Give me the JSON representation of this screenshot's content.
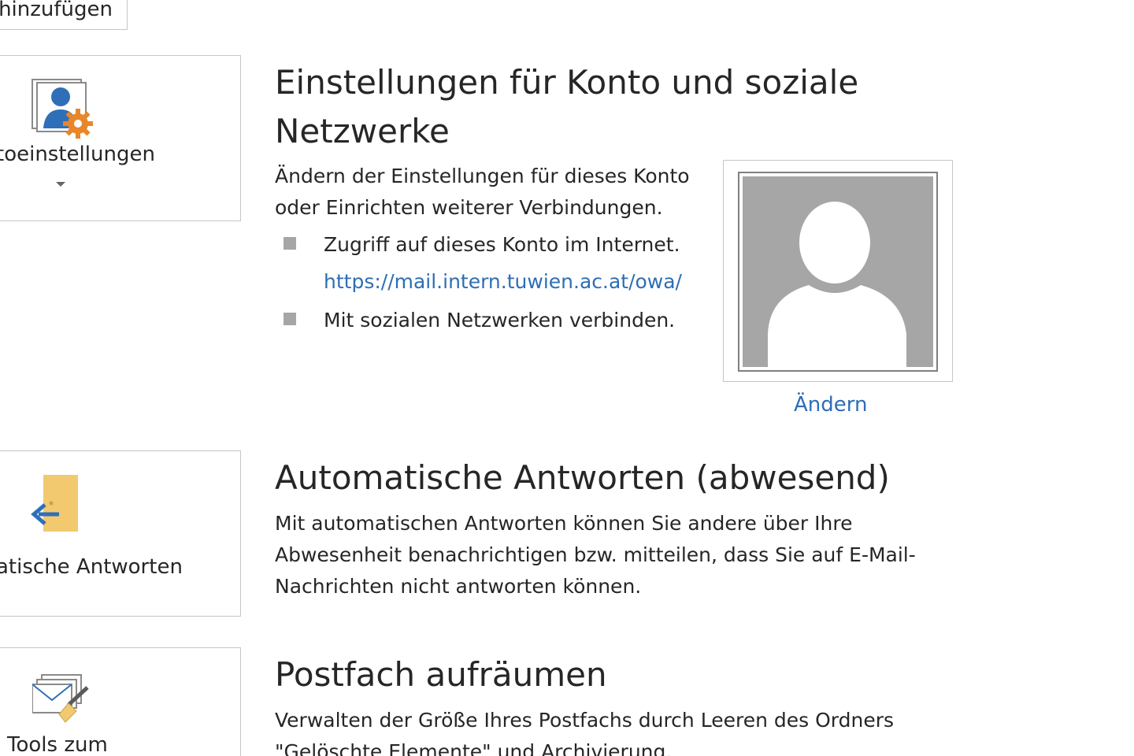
{
  "top_button": {
    "label": "hinzufügen"
  },
  "account_settings": {
    "tile_label": "toeinstellungen",
    "title_line1": "Einstellungen für Konto und soziale",
    "title_line2": "Netzwerke",
    "desc_line1": "Ändern der Einstellungen für dieses Konto",
    "desc_line2": "oder Einrichten weiterer Verbindungen.",
    "bullet1": "Zugriff auf dieses Konto im Internet.",
    "bullet1_link": "https://mail.intern.tuwien.ac.at/owa/",
    "bullet2": "Mit sozialen Netzwerken verbinden.",
    "photo_change_label": "Ändern"
  },
  "auto_reply": {
    "tile_label": "atische Antworten",
    "title": "Automatische Antworten (abwesend)",
    "desc_line1": "Mit automatischen Antworten können Sie andere über Ihre",
    "desc_line2": "Abwesenheit benachrichtigen bzw. mitteilen, dass Sie auf E-Mail-",
    "desc_line3": "Nachrichten nicht antworten können."
  },
  "cleanup": {
    "tile_label": "Tools zum",
    "title": "Postfach aufräumen",
    "desc_line1": "Verwalten der Größe Ihres Postfachs durch Leeren des Ordners",
    "desc_line2": "\"Gelöschte Elemente\" und Archivierung."
  },
  "colors": {
    "link": "#2e6eb5",
    "border": "#c6c6c6",
    "bullet": "#a6a6a6",
    "avatar_gray": "#a6a6a6",
    "icon_orange": "#e8862a",
    "icon_blue": "#2f6fb7",
    "icon_yellow": "#f2c96e"
  },
  "icons": {
    "account_tile": "account-settings-icon",
    "auto_reply_tile": "out-of-office-icon",
    "cleanup_tile": "cleanup-tools-icon",
    "avatar": "person-placeholder-icon"
  }
}
